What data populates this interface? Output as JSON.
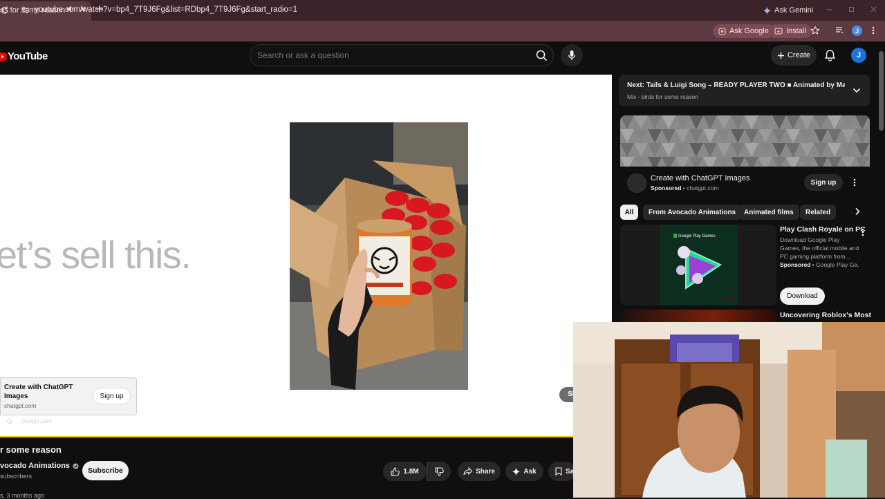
{
  "browser": {
    "tab_title": "ds for some reason - You",
    "ask_gemini": "Ask Gemini",
    "url": "youtube.com/watch?v=bp4_7T9J6Fg&list=RDbp4_7T9J6Fg&start_radio=1",
    "ask_google": "Ask Google",
    "install": "Install",
    "profile_initial": "J"
  },
  "header": {
    "logo_text": "YouTube",
    "search_placeholder": "Search or ask a question",
    "create_label": "Create",
    "avatar_initial": "J"
  },
  "player": {
    "overlay_text": "et’s sell this.",
    "overlay_ad": {
      "title": "Create with ChatGPT Images",
      "domain": "chatgpt.com",
      "signup": "Sign up",
      "meta": "chatgpt.com"
    },
    "skip_label": "Sk"
  },
  "video": {
    "title": "r some reason",
    "channel": "vocado Animations",
    "subscribers": "subscribers",
    "subscribe_label": "Subscribe",
    "likes": "1.8M",
    "share_label": "Share",
    "ask_label": "Ask",
    "save_label": "Sa",
    "date_line": "s, 3 months ago"
  },
  "sidebar": {
    "next": {
      "title": "Next: Tails & Luigi Song – READY PLAYER TWO ■ Animated by Mashe...",
      "subtitle": "Mix - birds for some reason"
    },
    "ad": {
      "title": "Create with ChatGPT Images",
      "sponsored": "Sponsored",
      "domain": "• chatgpt.com",
      "signup": "Sign up"
    },
    "chips": [
      "All",
      "From Avocado Animations",
      "Animated films",
      "Related"
    ],
    "promo": {
      "title": "Play Clash Royale on PC",
      "description": "Download Google Play Games, the official mobile and PC gaming platform from...",
      "sponsored": "Sponsored",
      "sponsor_name": "• Google Play Ga...",
      "download": "Download",
      "thumb_brand": "Google Play Games"
    },
    "rec_title": "Uncovering Roblox's Most"
  },
  "colors": {
    "tab_bar": "#3b2329",
    "omnibar": "#5b3a41",
    "yt_red": "#ff0000",
    "progress_accent": "#e8c400",
    "avatar_blue": "#1c73d8"
  },
  "icons": [
    "audio-icon",
    "close-icon",
    "plus-icon",
    "sparkle-icon",
    "reload-icon",
    "site-info-icon",
    "star-icon",
    "search-icon",
    "mic-icon",
    "bell-icon",
    "like-icon",
    "dislike-icon",
    "share-icon",
    "save-icon",
    "chevron-down-icon",
    "chevron-right-icon",
    "more-vert-icon"
  ]
}
